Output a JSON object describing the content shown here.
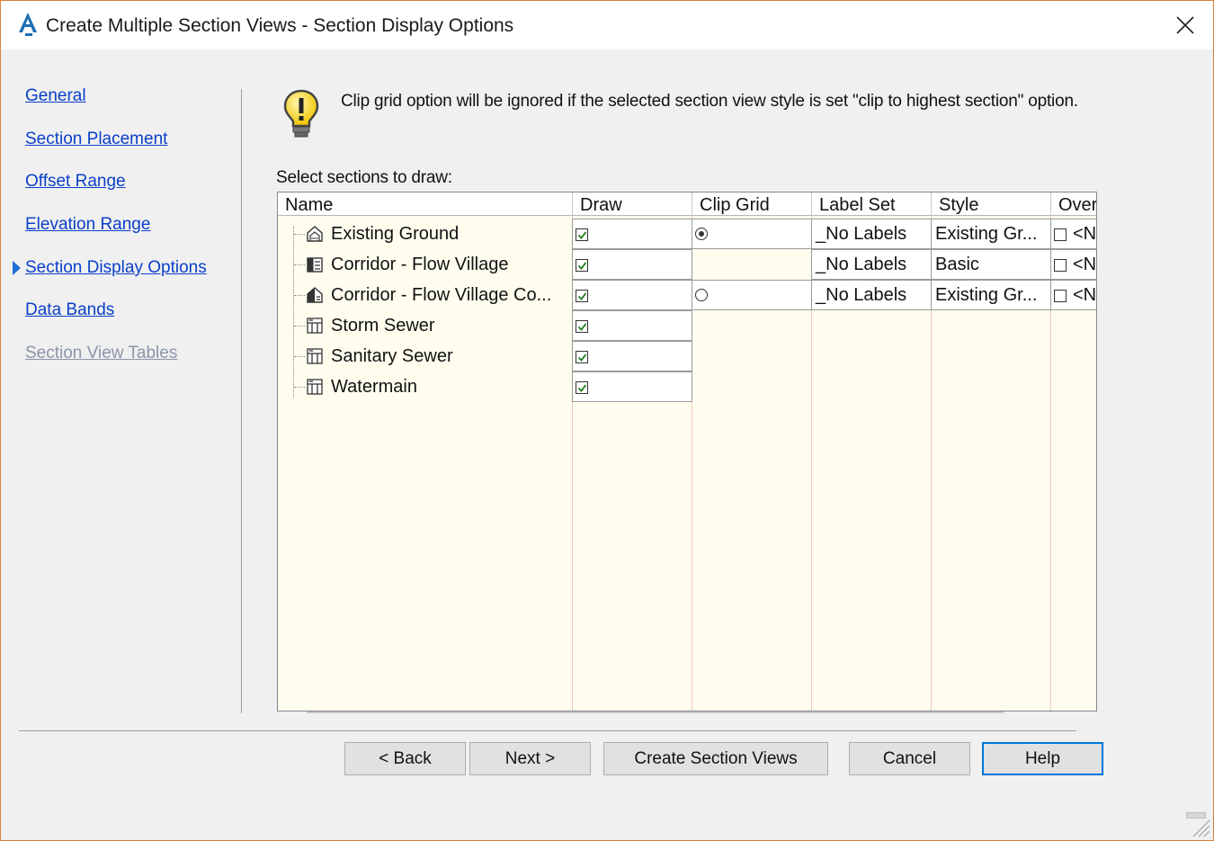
{
  "window": {
    "title": "Create Multiple Section Views - Section Display Options",
    "accent_color": "#d7833f"
  },
  "nav": {
    "items": [
      {
        "label": "General",
        "active": false,
        "enabled": true
      },
      {
        "label": "Section Placement",
        "active": false,
        "enabled": true
      },
      {
        "label": "Offset Range",
        "active": false,
        "enabled": true
      },
      {
        "label": "Elevation Range",
        "active": false,
        "enabled": true
      },
      {
        "label": "Section Display Options",
        "active": true,
        "enabled": true
      },
      {
        "label": "Data Bands",
        "active": false,
        "enabled": true
      },
      {
        "label": "Section View Tables",
        "active": false,
        "enabled": false
      }
    ]
  },
  "info": {
    "icon": "lightbulb-icon",
    "message": "Clip grid option will be ignored if the selected section view style is set \"clip to highest section\" option."
  },
  "grid": {
    "label": "Select sections to draw:",
    "columns": [
      "Name",
      "Draw",
      "Clip Grid",
      "Label Set",
      "Style",
      "Overr"
    ],
    "rows": [
      {
        "name": "Existing Ground",
        "icon": "surface-icon",
        "draw": true,
        "clip_grid": "selected",
        "label_set": "_No Labels",
        "style": "Existing Gr...",
        "override": false,
        "override_text": "<N"
      },
      {
        "name": "Corridor - Flow Village",
        "icon": "corridor-icon",
        "draw": true,
        "clip_grid": "none",
        "label_set": "_No Labels",
        "style": "Basic",
        "override": false,
        "override_text": "<N"
      },
      {
        "name": "Corridor - Flow Village Co...",
        "icon": "corridor-surface-icon",
        "draw": true,
        "clip_grid": "unselected",
        "label_set": "_No Labels",
        "style": "Existing Gr...",
        "override": false,
        "override_text": "<N"
      },
      {
        "name": "Storm Sewer",
        "icon": "pipe-network-icon",
        "draw": true
      },
      {
        "name": "Sanitary Sewer",
        "icon": "pipe-network-icon",
        "draw": true
      },
      {
        "name": "Watermain",
        "icon": "pipe-network-icon",
        "draw": true
      }
    ]
  },
  "buttons": {
    "back": "< Back",
    "next": "Next >",
    "create": "Create Section Views",
    "cancel": "Cancel",
    "help": "Help"
  }
}
